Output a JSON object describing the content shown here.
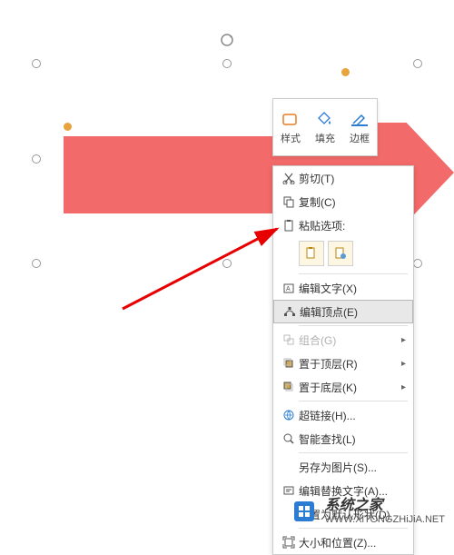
{
  "toolbar": {
    "style": "样式",
    "fill": "填充",
    "border": "边框"
  },
  "menu": {
    "cut": "剪切(T)",
    "copy": "复制(C)",
    "paste_options": "粘贴选项:",
    "edit_text": "编辑文字(X)",
    "edit_points": "编辑顶点(E)",
    "group": "组合(G)",
    "bring_front": "置于顶层(R)",
    "send_back": "置于底层(K)",
    "hyperlink": "超链接(H)...",
    "smart_lookup": "智能查找(L)",
    "save_as_picture": "另存为图片(S)...",
    "edit_alt_text": "编辑替换文字(A)...",
    "set_default": "设置为默认形状(D)",
    "size_position": "大小和位置(Z)..."
  },
  "watermark": {
    "name": "系统之家",
    "url": "WWW.XiTONGZHiJiA.NET"
  },
  "colors": {
    "shape_fill": "#f26a6a",
    "accent_blue": "#2b7cd3"
  }
}
